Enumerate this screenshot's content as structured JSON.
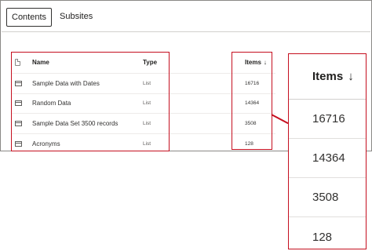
{
  "tabs": [
    {
      "label": "Contents",
      "active": true
    },
    {
      "label": "Subsites",
      "active": false
    }
  ],
  "columns": {
    "name": "Name",
    "type": "Type",
    "items": "Items",
    "sort_indicator": "↓"
  },
  "rows": [
    {
      "name": "Sample Data with Dates",
      "type": "List",
      "items": "16716"
    },
    {
      "name": "Random Data",
      "type": "List",
      "items": "14364"
    },
    {
      "name": "Sample Data Set 3500 records",
      "type": "List",
      "items": "3508"
    },
    {
      "name": "Acronyms",
      "type": "List",
      "items": "128"
    }
  ],
  "zoom": {
    "header": "Items",
    "sort_indicator": "↓",
    "values": [
      "16716",
      "14364",
      "3508",
      "128"
    ]
  },
  "colors": {
    "highlight": "#c50f1f",
    "text": "#323130"
  },
  "icons": {
    "header": "document-icon",
    "row": "list-icon"
  }
}
